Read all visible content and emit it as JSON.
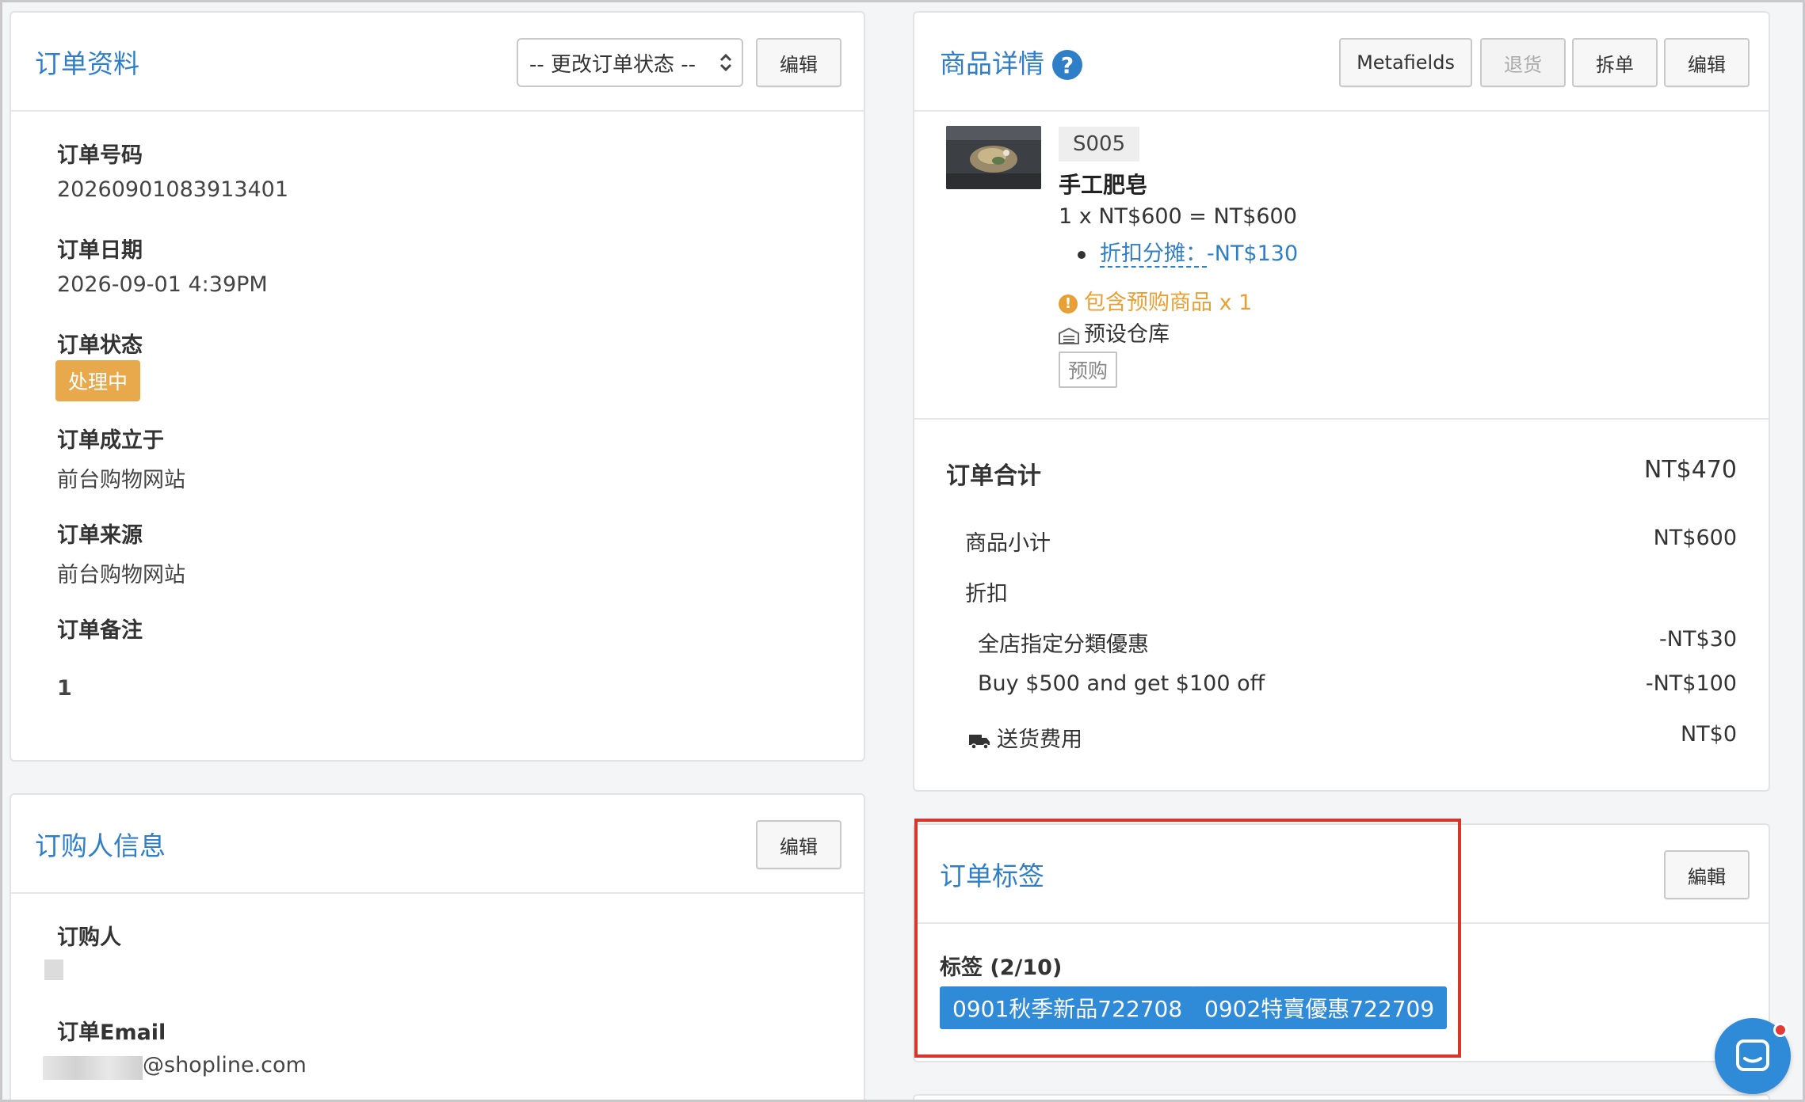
{
  "order_info": {
    "title": "订单资料",
    "status_select": "-- 更改订单状态 --",
    "edit_label": "编辑",
    "fields": {
      "order_number_label": "订单号码",
      "order_number": "20260901083913401",
      "order_date_label": "订单日期",
      "order_date": "2026-09-01 4:39PM",
      "order_status_label": "订单状态",
      "order_status": "处理中",
      "created_at_label": "订单成立于",
      "created_at": "前台购物网站",
      "source_label": "订单来源",
      "source": "前台购物网站",
      "note_label": "订单备注",
      "note": "1"
    }
  },
  "buyer_info": {
    "title": "订购人信息",
    "edit_label": "编辑",
    "buyer_label": "订购人",
    "email_label": "订单Email",
    "email_domain": "@shopline.com"
  },
  "product_details": {
    "title": "商品详情",
    "help_icon": "?",
    "buttons": {
      "metafields": "Metafields",
      "return": "退货",
      "split": "拆单",
      "edit": "编辑"
    },
    "item": {
      "sku": "S005",
      "name": "手工肥皂",
      "price_line": "1 x NT$600 = NT$600",
      "discount_label": "折扣分摊：",
      "discount_value": "-NT$130",
      "preorder_notice": "包含预购商品 x 1",
      "warehouse": "预设仓库",
      "preorder_tag": "预购"
    }
  },
  "order_total": {
    "title": "订单合计",
    "total": "NT$470",
    "subtotal_label": "商品小计",
    "subtotal": "NT$600",
    "discount_label": "折扣",
    "discounts": [
      {
        "label": "全店指定分類優惠",
        "value": "-NT$30"
      },
      {
        "label": "Buy $500 and get $100 off",
        "value": "-NT$100"
      }
    ],
    "shipping_label": "送货费用",
    "shipping": "NT$0"
  },
  "order_tags": {
    "title": "订单标签",
    "edit_label": "編輯",
    "tags_label": "标签 (2/10)",
    "tags": [
      "0901秋季新品722708",
      "0902特賣優惠722709"
    ]
  },
  "colors": {
    "accent_blue": "#2f7ec8",
    "status_orange": "#e8a94c",
    "warning_orange": "#e8a035",
    "highlight_red": "#d9362b"
  }
}
